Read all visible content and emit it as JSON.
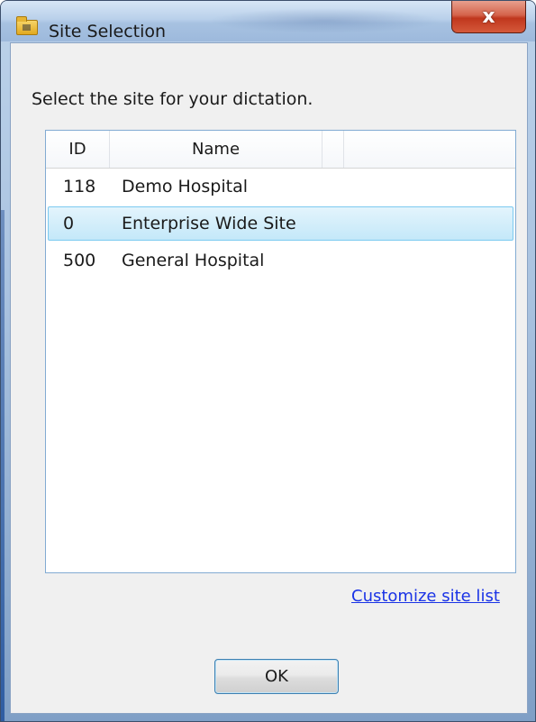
{
  "window": {
    "title": "Site Selection",
    "close_glyph": "x",
    "icon": "folder-icon"
  },
  "instruction": "Select the site for your dictation.",
  "list": {
    "columns": [
      "ID",
      "Name"
    ],
    "rows": [
      {
        "id": "118",
        "name": "Demo Hospital",
        "selected": false
      },
      {
        "id": "0",
        "name": "Enterprise Wide Site",
        "selected": true
      },
      {
        "id": "500",
        "name": "General Hospital",
        "selected": false
      }
    ]
  },
  "link": "Customize site list",
  "ok_label": "OK",
  "colors": {
    "selection": "#c4e8f9",
    "link": "#1a33e6",
    "close": "#c0371d"
  }
}
